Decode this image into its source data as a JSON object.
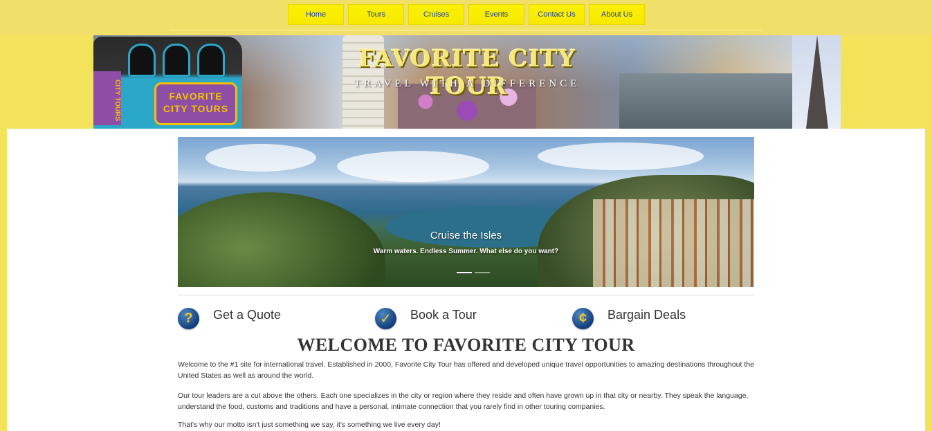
{
  "nav": {
    "items": [
      "Home",
      "Tours",
      "Cruises",
      "Events",
      "Contact Us",
      "About Us"
    ]
  },
  "banner": {
    "title": "FAVORITE CITY TOUR",
    "tagline": "TRAVEL WITH A DIFFERENCE",
    "tram_logo": "FAVORITE CITY TOURS"
  },
  "carousel": {
    "caption_title": "Cruise the Isles",
    "caption_text": "Warm waters. Endless Summer. What else do you want?",
    "slide_count": 2,
    "active_slide": 0
  },
  "features": [
    {
      "label": "Get a Quote",
      "icon": "question-icon",
      "glyph": "?"
    },
    {
      "label": "Book a Tour",
      "icon": "check-icon",
      "glyph": "✓"
    },
    {
      "label": "Bargain Deals",
      "icon": "cent-icon",
      "glyph": "¢"
    }
  ],
  "welcome": {
    "title": "WELCOME TO FAVORITE CITY TOUR",
    "paragraphs": [
      "Welcome to the #1 site for international travel. Established in 2000, Favorite City Tour has offered and developed unique travel opportunities to amazing destinations throughout the United States as well as around the world.",
      "Our tour leaders are a cut above the others. Each one specializes in the city or region where they reside and often have grown up in that city or nearby. They speak the language, understand the food, customs and traditions and have a personal, intimate connection that you rarely find in other touring companies.",
      "That's why our motto isn't just something we say, it's something we live every day!"
    ]
  },
  "colors": {
    "page_background": "#f2e35a",
    "nav_button": "#fbf000",
    "nav_text": "#1b3fa0",
    "content_background": "#ffffff",
    "icon_blue": "#123e7a",
    "icon_gold": "#f2cc1c"
  }
}
